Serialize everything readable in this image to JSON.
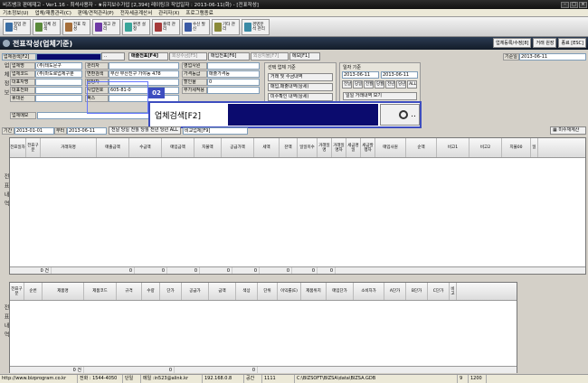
{
  "window": {
    "title": "비즈뱅크 판매재고 - Ver1.16 - 최석사용자 - ★유지보수가입 [2,394] 레이팅크          작업일자 : 2013-06-11(화) - [전표작성]"
  },
  "menu": [
    "기초정보(U)",
    "업체/재품관리(C)",
    "판매/견적관리(P)",
    "전자세금계산서",
    "관리자(X)",
    "프로그램종료"
  ],
  "toolbar": [
    {
      "label": "창업 관리",
      "color": "#3a6ea5"
    },
    {
      "label": "업체 검색",
      "color": "#5a8a3a"
    },
    {
      "label": "전표 작성",
      "color": "#a56e3a"
    },
    {
      "label": "재고 관리",
      "color": "#6e3aa5"
    },
    {
      "label": "환경 설정",
      "color": "#3aa59a"
    },
    {
      "label": "출력 관리",
      "color": "#a53a3a"
    },
    {
      "label": "수신 발신",
      "color": "#3a5aa5"
    },
    {
      "label": "기타 관리",
      "color": "#8a8a3a"
    },
    {
      "label": "경영분석 관리",
      "color": "#3a8aa5"
    }
  ],
  "header": {
    "title": "전표작성(업체기준)",
    "right_buttons": [
      "업체등록/수정[8]",
      "거래 원장",
      "종료 [ESC]"
    ]
  },
  "filter_row": {
    "search_label": "업체검색[F2]",
    "search_btn": "..",
    "tabs": [
      "매출전표[F4]",
      "회상수금[F5]",
      "매입전표[F6]",
      "외상지불[F7]",
      "메모[F1]"
    ],
    "date_label": "기준일",
    "date_value": "2013-06-11"
  },
  "company": {
    "side_label": "업체정보",
    "fields": [
      {
        "label": "업체명",
        "value": "(주)테도문구"
      },
      {
        "label": "업체코드",
        "value": "(주)마도로업체구분"
      },
      {
        "label": "대표자명",
        "value": ""
      },
      {
        "label": "대표전화",
        "value": ""
      },
      {
        "label": "휴대폰",
        "value": ""
      },
      {
        "label": "업체메모",
        "value": ""
      }
    ],
    "mid_fields": [
      {
        "label": "관리자",
        "value": ""
      },
      {
        "label": "변환검색",
        "value": "부산 부산진구 가야동 478"
      },
      {
        "label": "담당자",
        "value": ""
      },
      {
        "label": "사업번호",
        "value": "605-81-0"
      },
      {
        "label": "팩스",
        "value": ""
      }
    ],
    "right_fields": [
      {
        "label": "영업사원",
        "value": ""
      },
      {
        "label": "가격등급",
        "value": "매출가격등"
      },
      {
        "label": "할인율",
        "value": "0"
      },
      {
        "label": "부가세적용",
        "value": ""
      }
    ]
  },
  "selected_panel": {
    "title": "선택 업체 기준",
    "buttons": [
      "거래 및 수금내역",
      "매입,매출내역(상세)",
      "미수확인 내역(상세)"
    ]
  },
  "date_panel": {
    "title": "일자 기준",
    "from": "2013-06-11",
    "to": "2013-06-11",
    "quick": [
      "전날",
      "당일",
      "전월",
      "당월",
      "전년",
      "당년",
      "ALL"
    ],
    "button": "일일 거래내역 보기"
  },
  "tooltip": {
    "badge": "02",
    "label": "업체검색[F2]",
    "btn": ".."
  },
  "period_row": {
    "label": "기간",
    "from": "2013-01-01",
    "sep": "부터",
    "to": "2013-06-11",
    "quick": "전날 당일 전월 당월 전년 당년 ALL",
    "picker": "비교업체[F9]",
    "right_button": "미수재계산"
  },
  "top_grid": {
    "side_label": "전표내역",
    "columns": [
      "전표일자",
      "전표구분",
      "거래처명",
      "매출금액",
      "수금액",
      "매입금액",
      "지불액",
      "공급가액",
      "세액",
      "잔액",
      "일일미수",
      "거래일명",
      "거래일명자",
      "세금명일",
      "세금발행자",
      "매입사원",
      "순액",
      "비고1",
      "비고2",
      "지불00",
      "일"
    ],
    "footer": [
      "0 건",
      "0",
      "0",
      "0",
      "0",
      "0",
      "0",
      "0",
      "0"
    ]
  },
  "bottom_grid": {
    "side_label": "전표내역",
    "columns": [
      "전표구분",
      "순번",
      "제품명",
      "제품코드",
      "규격",
      "수량",
      "단가",
      "공급가",
      "금액",
      "색상",
      "단위",
      "이익률(E)",
      "제품위치",
      "매입단가",
      "소비자가",
      "A단가",
      "B단가",
      "C단가",
      "비고"
    ],
    "footer": [
      "0 건",
      "0",
      "0"
    ]
  },
  "status": [
    "http://www.bizprogram.co.kr",
    "전화 : 1544-4050",
    "단일",
    "메일 :in523@alink.kr",
    "192.168.0.8",
    "공간",
    "1111",
    "C:\\BIZSOFT\\BIZSA\\data\\BIZSA.GDB",
    "9",
    "1200"
  ]
}
